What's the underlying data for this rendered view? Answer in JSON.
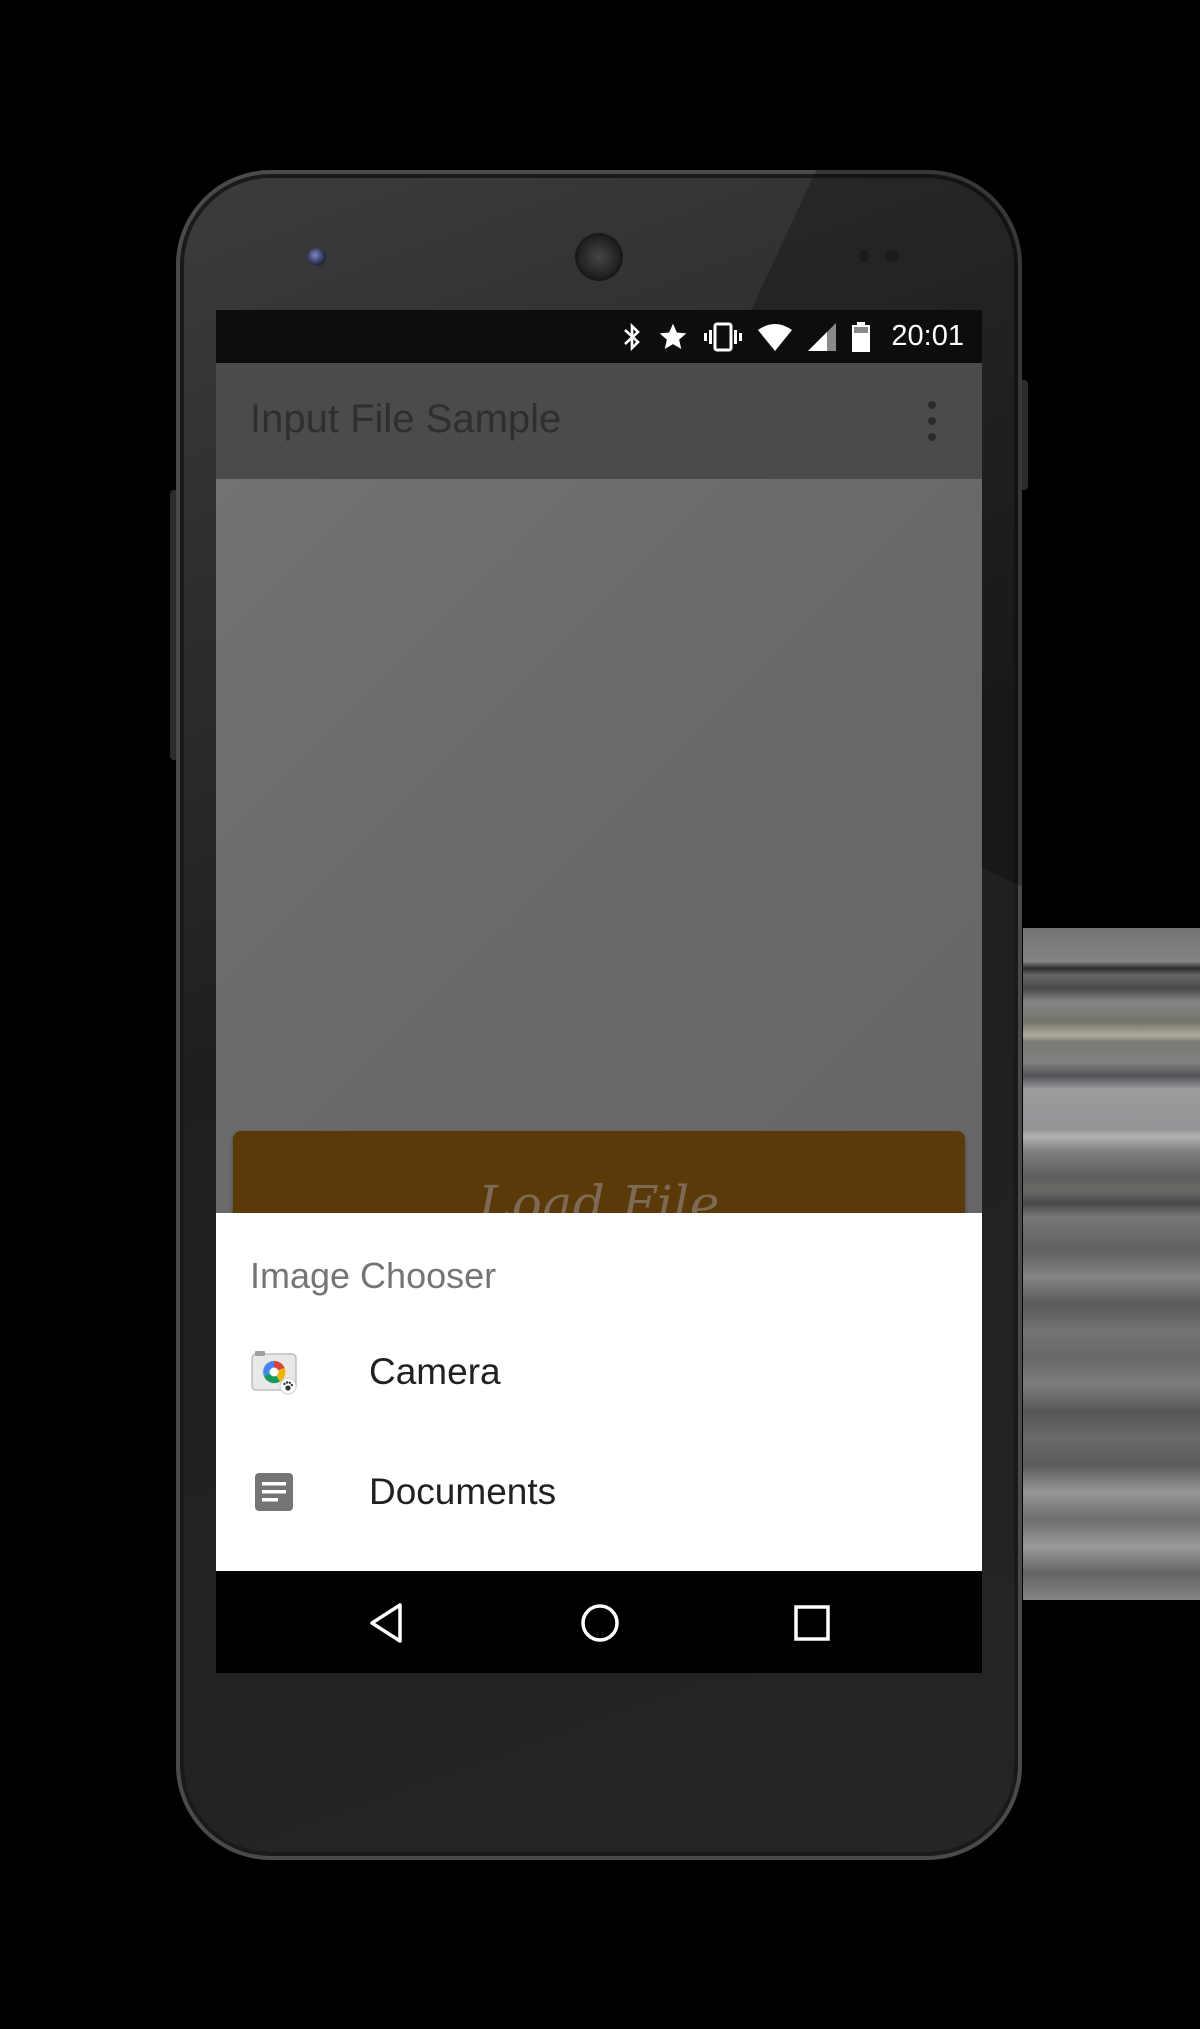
{
  "status_bar": {
    "time": "20:01",
    "icons": [
      "bluetooth-icon",
      "star-icon",
      "vibrate-icon",
      "wifi-icon",
      "signal-icon",
      "battery-icon"
    ]
  },
  "app_bar": {
    "title": "Input File Sample",
    "overflow_icon": "more-vert-icon"
  },
  "main": {
    "load_button_label": "Load File",
    "load_button_color": "#5a3a08"
  },
  "chooser": {
    "title": "Image Chooser",
    "items": [
      {
        "label": "Camera",
        "icon": "camera-app-icon"
      },
      {
        "label": "Documents",
        "icon": "documents-icon"
      }
    ]
  },
  "nav_bar": {
    "buttons": [
      "back-icon",
      "home-icon",
      "recents-icon"
    ]
  }
}
